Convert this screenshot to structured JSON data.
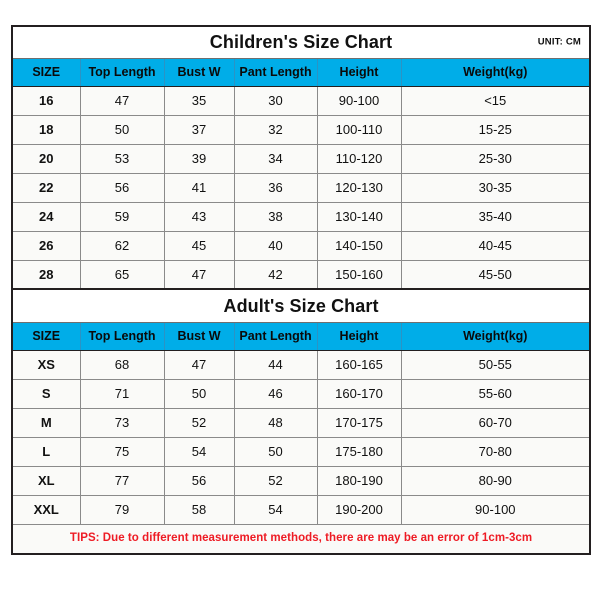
{
  "page": {
    "background": "#ffffff",
    "accent_blue": "#00ade8",
    "tips_red": "#ee1b24",
    "text_color": "#111111"
  },
  "children_chart": {
    "title": "Children's Size Chart",
    "unit_label": "UNIT: CM",
    "columns": [
      "SIZE",
      "Top Length",
      "Bust W",
      "Pant Length",
      "Height",
      "Weight(kg)"
    ],
    "rows": [
      [
        "16",
        "47",
        "35",
        "30",
        "90-100",
        "<15"
      ],
      [
        "18",
        "50",
        "37",
        "32",
        "100-110",
        "15-25"
      ],
      [
        "20",
        "53",
        "39",
        "34",
        "110-120",
        "25-30"
      ],
      [
        "22",
        "56",
        "41",
        "36",
        "120-130",
        "30-35"
      ],
      [
        "24",
        "59",
        "43",
        "38",
        "130-140",
        "35-40"
      ],
      [
        "26",
        "62",
        "45",
        "40",
        "140-150",
        "40-45"
      ],
      [
        "28",
        "65",
        "47",
        "42",
        "150-160",
        "45-50"
      ]
    ]
  },
  "adult_chart": {
    "title": "Adult's Size Chart",
    "columns": [
      "SIZE",
      "Top Length",
      "Bust W",
      "Pant Length",
      "Height",
      "Weight(kg)"
    ],
    "rows": [
      [
        "XS",
        "68",
        "47",
        "44",
        "160-165",
        "50-55"
      ],
      [
        "S",
        "71",
        "50",
        "46",
        "160-170",
        "55-60"
      ],
      [
        "M",
        "73",
        "52",
        "48",
        "170-175",
        "60-70"
      ],
      [
        "L",
        "75",
        "54",
        "50",
        "175-180",
        "70-80"
      ],
      [
        "XL",
        "77",
        "56",
        "52",
        "180-190",
        "80-90"
      ],
      [
        "XXL",
        "79",
        "58",
        "54",
        "190-200",
        "90-100"
      ]
    ]
  },
  "tips": {
    "text": "TIPS: Due to different measurement methods, there are may be an error of 1cm-3cm"
  },
  "chart_data": {
    "type": "table",
    "title": "Clothing Size Charts (Children's and Adult's)",
    "unit": "CM",
    "tables": [
      {
        "name": "Children's Size Chart",
        "columns": [
          "SIZE",
          "Top Length",
          "Bust W",
          "Pant Length",
          "Height",
          "Weight(kg)"
        ],
        "rows": [
          [
            "16",
            "47",
            "35",
            "30",
            "90-100",
            "<15"
          ],
          [
            "18",
            "50",
            "37",
            "32",
            "100-110",
            "15-25"
          ],
          [
            "20",
            "53",
            "39",
            "34",
            "110-120",
            "25-30"
          ],
          [
            "22",
            "56",
            "41",
            "36",
            "120-130",
            "30-35"
          ],
          [
            "24",
            "59",
            "43",
            "38",
            "130-140",
            "35-40"
          ],
          [
            "26",
            "62",
            "45",
            "40",
            "140-150",
            "40-45"
          ],
          [
            "28",
            "65",
            "47",
            "42",
            "150-160",
            "45-50"
          ]
        ]
      },
      {
        "name": "Adult's Size Chart",
        "columns": [
          "SIZE",
          "Top Length",
          "Bust W",
          "Pant Length",
          "Height",
          "Weight(kg)"
        ],
        "rows": [
          [
            "XS",
            "68",
            "47",
            "44",
            "160-165",
            "50-55"
          ],
          [
            "S",
            "71",
            "50",
            "46",
            "160-170",
            "55-60"
          ],
          [
            "M",
            "73",
            "52",
            "48",
            "170-175",
            "60-70"
          ],
          [
            "L",
            "75",
            "54",
            "50",
            "175-180",
            "70-80"
          ],
          [
            "XL",
            "77",
            "56",
            "52",
            "180-190",
            "80-90"
          ],
          [
            "XXL",
            "79",
            "58",
            "54",
            "190-200",
            "90-100"
          ]
        ]
      }
    ],
    "footnote": "TIPS: Due to different measurement methods, there are may be an error of 1cm-3cm"
  }
}
